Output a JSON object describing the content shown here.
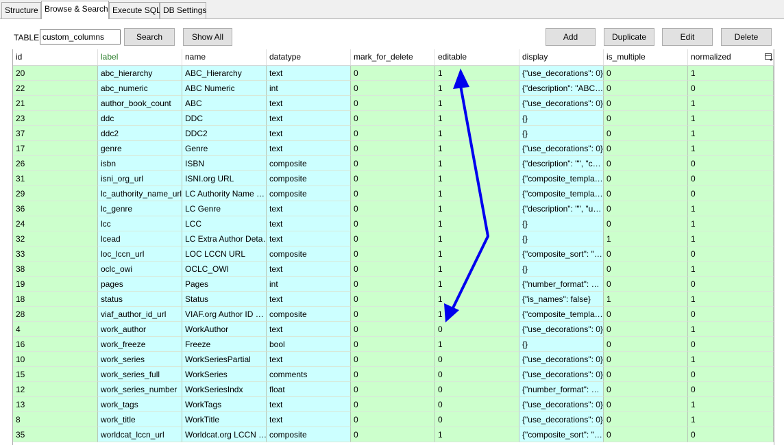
{
  "tabs": [
    {
      "label": "Structure",
      "active": false
    },
    {
      "label": "Browse & Search",
      "active": true
    },
    {
      "label": "Execute SQL",
      "active": false
    },
    {
      "label": "DB Settings",
      "active": false
    }
  ],
  "toolbar": {
    "table_label": "TABLE",
    "table_value": "custom_columns",
    "search_label": "Search",
    "show_all_label": "Show All",
    "add_label": "Add",
    "duplicate_label": "Duplicate",
    "edit_label": "Edit",
    "delete_label": "Delete"
  },
  "grid": {
    "columns": [
      "id",
      "label",
      "name",
      "datatype",
      "mark_for_delete",
      "editable",
      "display",
      "is_multiple",
      "normalized"
    ],
    "header_icon": "column-menu-icon",
    "colors": {
      "green": "#ccffcc",
      "cyan": "#ccffff",
      "label_header": "#2a7d2a"
    },
    "rows": [
      [
        "20",
        "abc_hierarchy",
        "ABC_Hierarchy",
        "text",
        "0",
        "1",
        "{\"use_decorations\": 0}",
        "0",
        "1"
      ],
      [
        "22",
        "abc_numeric",
        "ABC Numeric",
        "int",
        "0",
        "1",
        "{\"description\": \"ABC…",
        "0",
        "0"
      ],
      [
        "21",
        "author_book_count",
        "ABC",
        "text",
        "0",
        "1",
        "{\"use_decorations\": 0}",
        "0",
        "1"
      ],
      [
        "23",
        "ddc",
        "DDC",
        "text",
        "0",
        "1",
        "{}",
        "0",
        "1"
      ],
      [
        "37",
        "ddc2",
        "DDC2",
        "text",
        "0",
        "1",
        "{}",
        "0",
        "1"
      ],
      [
        "17",
        "genre",
        "Genre",
        "text",
        "0",
        "1",
        "{\"use_decorations\": 0}",
        "0",
        "1"
      ],
      [
        "26",
        "isbn",
        "ISBN",
        "composite",
        "0",
        "1",
        "{\"description\": \"\", \"c…",
        "0",
        "0"
      ],
      [
        "31",
        "isni_org_url",
        "ISNI.org URL",
        "composite",
        "0",
        "1",
        "{\"composite_templa…",
        "0",
        "0"
      ],
      [
        "29",
        "lc_authority_name_url",
        "LC Authority Name …",
        "composite",
        "0",
        "1",
        "{\"composite_templa…",
        "0",
        "0"
      ],
      [
        "36",
        "lc_genre",
        "LC Genre",
        "text",
        "0",
        "1",
        "{\"description\": \"\", \"u…",
        "0",
        "1"
      ],
      [
        "24",
        "lcc",
        "LCC",
        "text",
        "0",
        "1",
        "{}",
        "0",
        "1"
      ],
      [
        "32",
        "lcead",
        "LC Extra Author Deta…",
        "text",
        "0",
        "1",
        "{}",
        "1",
        "1"
      ],
      [
        "33",
        "loc_lccn_url",
        "LOC LCCN URL",
        "composite",
        "0",
        "1",
        "{\"composite_sort\": \"…",
        "0",
        "0"
      ],
      [
        "38",
        "oclc_owi",
        "OCLC_OWI",
        "text",
        "0",
        "1",
        "{}",
        "0",
        "1"
      ],
      [
        "19",
        "pages",
        "Pages",
        "int",
        "0",
        "1",
        "{\"number_format\": …",
        "0",
        "0"
      ],
      [
        "18",
        "status",
        "Status",
        "text",
        "0",
        "1",
        "{\"is_names\": false}",
        "1",
        "1"
      ],
      [
        "28",
        "viaf_author_id_url",
        "VIAF.org Author ID …",
        "composite",
        "0",
        "1",
        "{\"composite_templa…",
        "0",
        "0"
      ],
      [
        "4",
        "work_author",
        "WorkAuthor",
        "text",
        "0",
        "0",
        "{\"use_decorations\": 0}",
        "0",
        "1"
      ],
      [
        "16",
        "work_freeze",
        "Freeze",
        "bool",
        "0",
        "1",
        "{}",
        "0",
        "0"
      ],
      [
        "10",
        "work_series",
        "WorkSeriesPartial",
        "text",
        "0",
        "0",
        "{\"use_decorations\": 0}",
        "0",
        "1"
      ],
      [
        "15",
        "work_series_full",
        "WorkSeries",
        "comments",
        "0",
        "0",
        "{\"use_decorations\": 0}",
        "0",
        "0"
      ],
      [
        "12",
        "work_series_number",
        "WorkSeriesIndx",
        "float",
        "0",
        "0",
        "{\"number_format\": …",
        "0",
        "0"
      ],
      [
        "13",
        "work_tags",
        "WorkTags",
        "text",
        "0",
        "0",
        "{\"use_decorations\": 0}",
        "0",
        "1"
      ],
      [
        "8",
        "work_title",
        "WorkTitle",
        "text",
        "0",
        "0",
        "{\"use_decorations\": 0}",
        "0",
        "1"
      ],
      [
        "35",
        "worldcat_lccn_url",
        "Worldcat.org LCCN …",
        "composite",
        "0",
        "1",
        "{\"composite_sort\": \"…",
        "0",
        "0"
      ]
    ]
  },
  "annotation": {
    "arrow_color": "#0000ee"
  }
}
